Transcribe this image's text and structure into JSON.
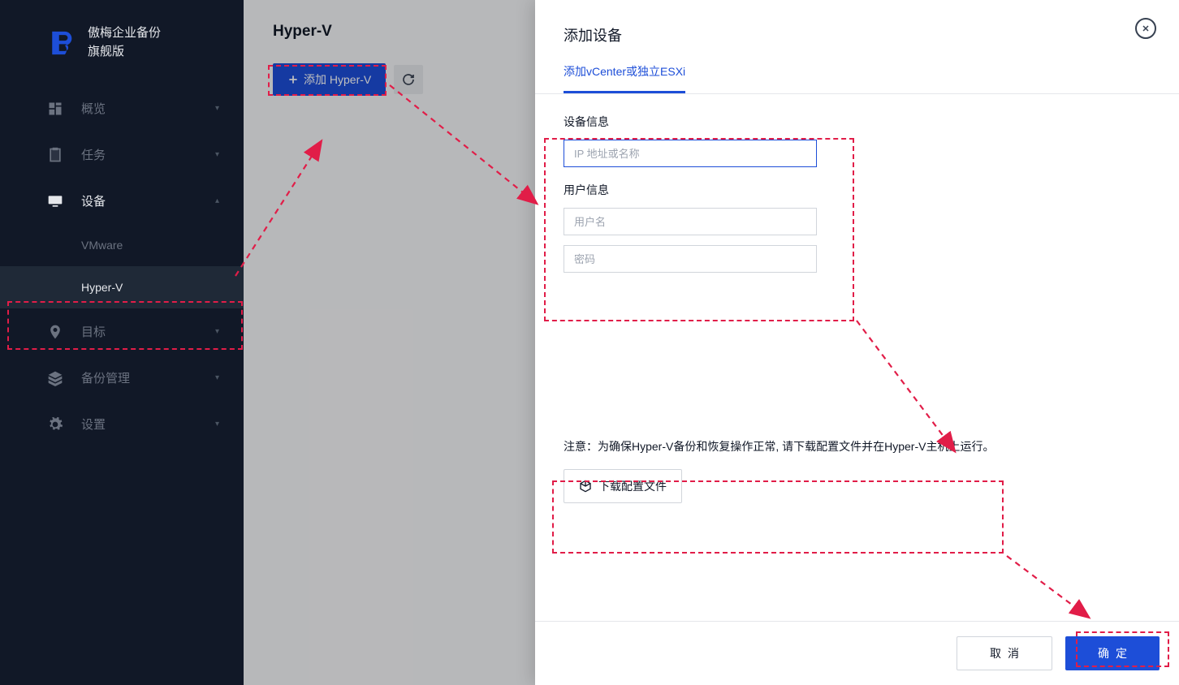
{
  "brand": {
    "line1": "傲梅企业备份",
    "line2": "旗舰版"
  },
  "nav": {
    "overview": "概览",
    "tasks": "任务",
    "devices": "设备",
    "device_sub": {
      "vmware": "VMware",
      "hyperv": "Hyper-V"
    },
    "targets": "目标",
    "backup_mgmt": "备份管理",
    "settings": "设置"
  },
  "main": {
    "title": "Hyper-V",
    "add_button": "添加 Hyper-V"
  },
  "panel": {
    "title": "添加设备",
    "tab": "添加vCenter或独立ESXi",
    "sections": {
      "device_info": "设备信息",
      "user_info": "用户信息"
    },
    "placeholders": {
      "ip": "IP 地址或名称",
      "username": "用户名",
      "password": "密码"
    },
    "notice": "注意：为确保Hyper-V备份和恢复操作正常, 请下载配置文件并在Hyper-V主机上运行。",
    "download_btn": "下载配置文件",
    "cancel": "取消",
    "confirm": "确定"
  }
}
